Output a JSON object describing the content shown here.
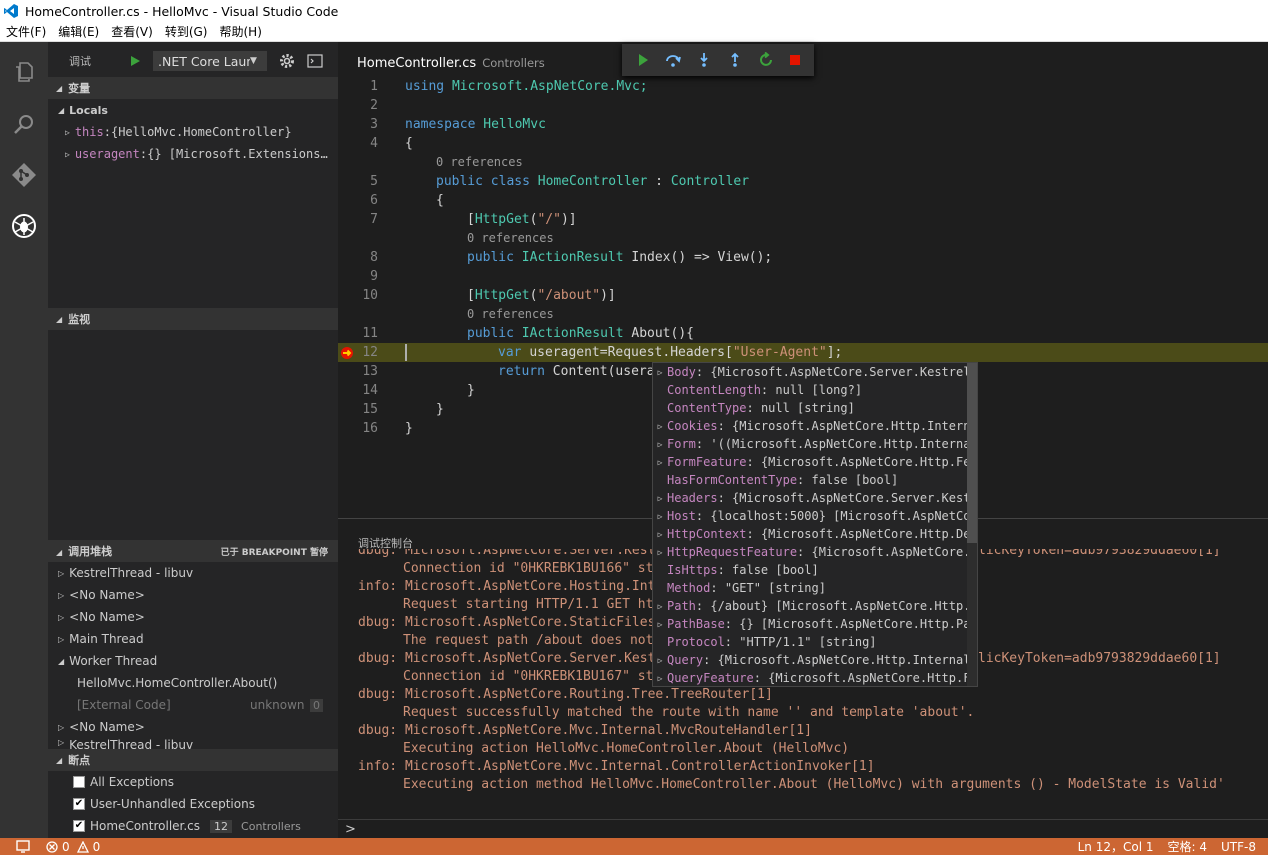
{
  "window": {
    "title": "HomeController.cs - HelloMvc - Visual Studio Code"
  },
  "menu": [
    "文件(F)",
    "编辑(E)",
    "查看(V)",
    "转到(G)",
    "帮助(H)"
  ],
  "debug_header": {
    "label": "调试",
    "config": ".NET Core Laun"
  },
  "variables": {
    "title": "变量",
    "locals_label": "Locals",
    "items": [
      {
        "name": "this",
        "value": "{HelloMvc.HomeController}"
      },
      {
        "name": "useragent",
        "value": "{} [Microsoft.Extensions…"
      }
    ]
  },
  "watch": {
    "title": "监视"
  },
  "callstack": {
    "title": "调用堆栈",
    "status": "已于 BREAKPOINT 暂停",
    "items": [
      {
        "label": "KestrelThread - libuv"
      },
      {
        "label": "<No Name>"
      },
      {
        "label": "<No Name>"
      },
      {
        "label": "Main Thread"
      },
      {
        "label": "Worker Thread"
      },
      {
        "label": "HelloMvc.HomeController.About()"
      },
      {
        "label": "[External Code]",
        "source": "unknown",
        "line": "0"
      },
      {
        "label": "<No Name>"
      },
      {
        "label": "KestrelThread - libuv"
      }
    ]
  },
  "breakpoints": {
    "title": "断点",
    "items": [
      {
        "label": "All Exceptions",
        "checked": false
      },
      {
        "label": "User-Unhandled Exceptions",
        "checked": true
      },
      {
        "label": "HomeController.cs",
        "checked": true,
        "line": "12",
        "folder": "Controllers"
      }
    ]
  },
  "tab": {
    "file": "HomeController.cs",
    "folder": "Controllers"
  },
  "code": {
    "l1": {
      "num": "1",
      "kw": "using",
      "rest": "Microsoft.AspNetCore.Mvc;"
    },
    "l2": {
      "num": "2"
    },
    "l3": {
      "num": "3",
      "kw": "namespace",
      "rest": "HelloMvc"
    },
    "l4": {
      "num": "4",
      "text": "{"
    },
    "lens1": "0 references",
    "l5": {
      "num": "5",
      "kw": "public class",
      "name": "HomeController",
      "sep": " : ",
      "base": "Controller"
    },
    "l6": {
      "num": "6",
      "text": "{"
    },
    "l7": {
      "num": "7",
      "a": "[",
      "attr": "HttpGet",
      "b": "(",
      "str": "\"/\"",
      "c": ")]"
    },
    "lens2": "0 references",
    "l8": {
      "num": "8",
      "kw": "public",
      "type": "IActionResult",
      "rest": "Index() => View();"
    },
    "l9": {
      "num": "9"
    },
    "l10": {
      "num": "10",
      "a": "[",
      "attr": "HttpGet",
      "b": "(",
      "str": "\"/about\"",
      "c": ")]"
    },
    "lens3": "0 references",
    "l11": {
      "num": "11",
      "kw": "public",
      "type": "IActionResult",
      "rest": "About(){"
    },
    "l12": {
      "num": "12",
      "kw": "var",
      "a": "useragent=Request.Headers[",
      "str": "\"User-Agent\"",
      "b": "];"
    },
    "l13": {
      "num": "13",
      "kw": "return",
      "rest": "Content(usera"
    },
    "l14": {
      "num": "14",
      "text": "}"
    },
    "l15": {
      "num": "15",
      "text": "}"
    },
    "l16": {
      "num": "16",
      "text": "}"
    }
  },
  "hover": [
    {
      "k": "Body",
      "v": "{Microsoft.AspNetCore.Server.Kestrel.",
      "exp": true
    },
    {
      "k": "ContentLength",
      "v": "null [long?]",
      "exp": false
    },
    {
      "k": "ContentType",
      "v": "null [string]",
      "exp": false
    },
    {
      "k": "Cookies",
      "v": "{Microsoft.AspNetCore.Http.Interna",
      "exp": true
    },
    {
      "k": "Form",
      "v": "'((Microsoft.AspNetCore.Http.Internal",
      "exp": true
    },
    {
      "k": "FormFeature",
      "v": "{Microsoft.AspNetCore.Http.Fea",
      "exp": true
    },
    {
      "k": "HasFormContentType",
      "v": "false [bool]",
      "exp": false
    },
    {
      "k": "Headers",
      "v": "{Microsoft.AspNetCore.Server.Kestr",
      "exp": true
    },
    {
      "k": "Host",
      "v": "{localhost:5000} [Microsoft.AspNetCor",
      "exp": true
    },
    {
      "k": "HttpContext",
      "v": "{Microsoft.AspNetCore.Http.Def",
      "exp": true
    },
    {
      "k": "HttpRequestFeature",
      "v": "{Microsoft.AspNetCore.S",
      "exp": true
    },
    {
      "k": "IsHttps",
      "v": "false [bool]",
      "exp": false
    },
    {
      "k": "Method",
      "v": "\"GET\" [string]",
      "exp": false
    },
    {
      "k": "Path",
      "v": "{/about} [Microsoft.AspNetCore.Http.P",
      "exp": true
    },
    {
      "k": "PathBase",
      "v": "{} [Microsoft.AspNetCore.Http.Pat",
      "exp": true
    },
    {
      "k": "Protocol",
      "v": "\"HTTP/1.1\" [string]",
      "exp": false
    },
    {
      "k": "Query",
      "v": "{Microsoft.AspNetCore.Http.Internal.",
      "exp": true
    },
    {
      "k": "QueryFeature",
      "v": "{Microsoft.AspNetCore.Http.Fe",
      "exp": true
    }
  ],
  "console": {
    "title": "调试控制台",
    "lines": [
      "dbug: Microsoft.AspNetCore.Server.Kest",
      "Connection id \"0HKREBK1BU166\" st",
      "info: Microsoft.AspNetCore.Hosting.Int",
      "Request starting HTTP/1.1 GET ht",
      "dbug: Microsoft.AspNetCore.StaticFiles",
      "The request path /about does not",
      "dbug: Microsoft.AspNetCore.Server.Kest",
      "Connection id \"0HKREBK1BU167\" st",
      "dbug: Microsoft.AspNetCore.Routing.Tree.TreeRouter[1]",
      "Request successfully matched the route with name '' and template 'about'.",
      "dbug: Microsoft.AspNetCore.Mvc.Internal.MvcRouteHandler[1]",
      "Executing action HelloMvc.HomeController.About (HelloMvc)",
      "info: Microsoft.AspNetCore.Mvc.Internal.ControllerActionInvoker[1]",
      "Executing action method HelloMvc.HomeController.About (HelloMvc) with arguments () - ModelState is Valid'"
    ],
    "tail_top": "licKeyToken=adb9793829ddae60[1]",
    "tail_mid": "licKeyToken=adb9793829ddae60[1]",
    "prompt": ">"
  },
  "status": {
    "errors": "0",
    "warnings": "0",
    "position": "Ln 12，Col 1",
    "indent": "空格: 4",
    "encoding": "UTF-8"
  },
  "colors": {
    "accent": "#cc6633",
    "highlight": "#4b4b18",
    "breakpoint": "#e51400"
  }
}
